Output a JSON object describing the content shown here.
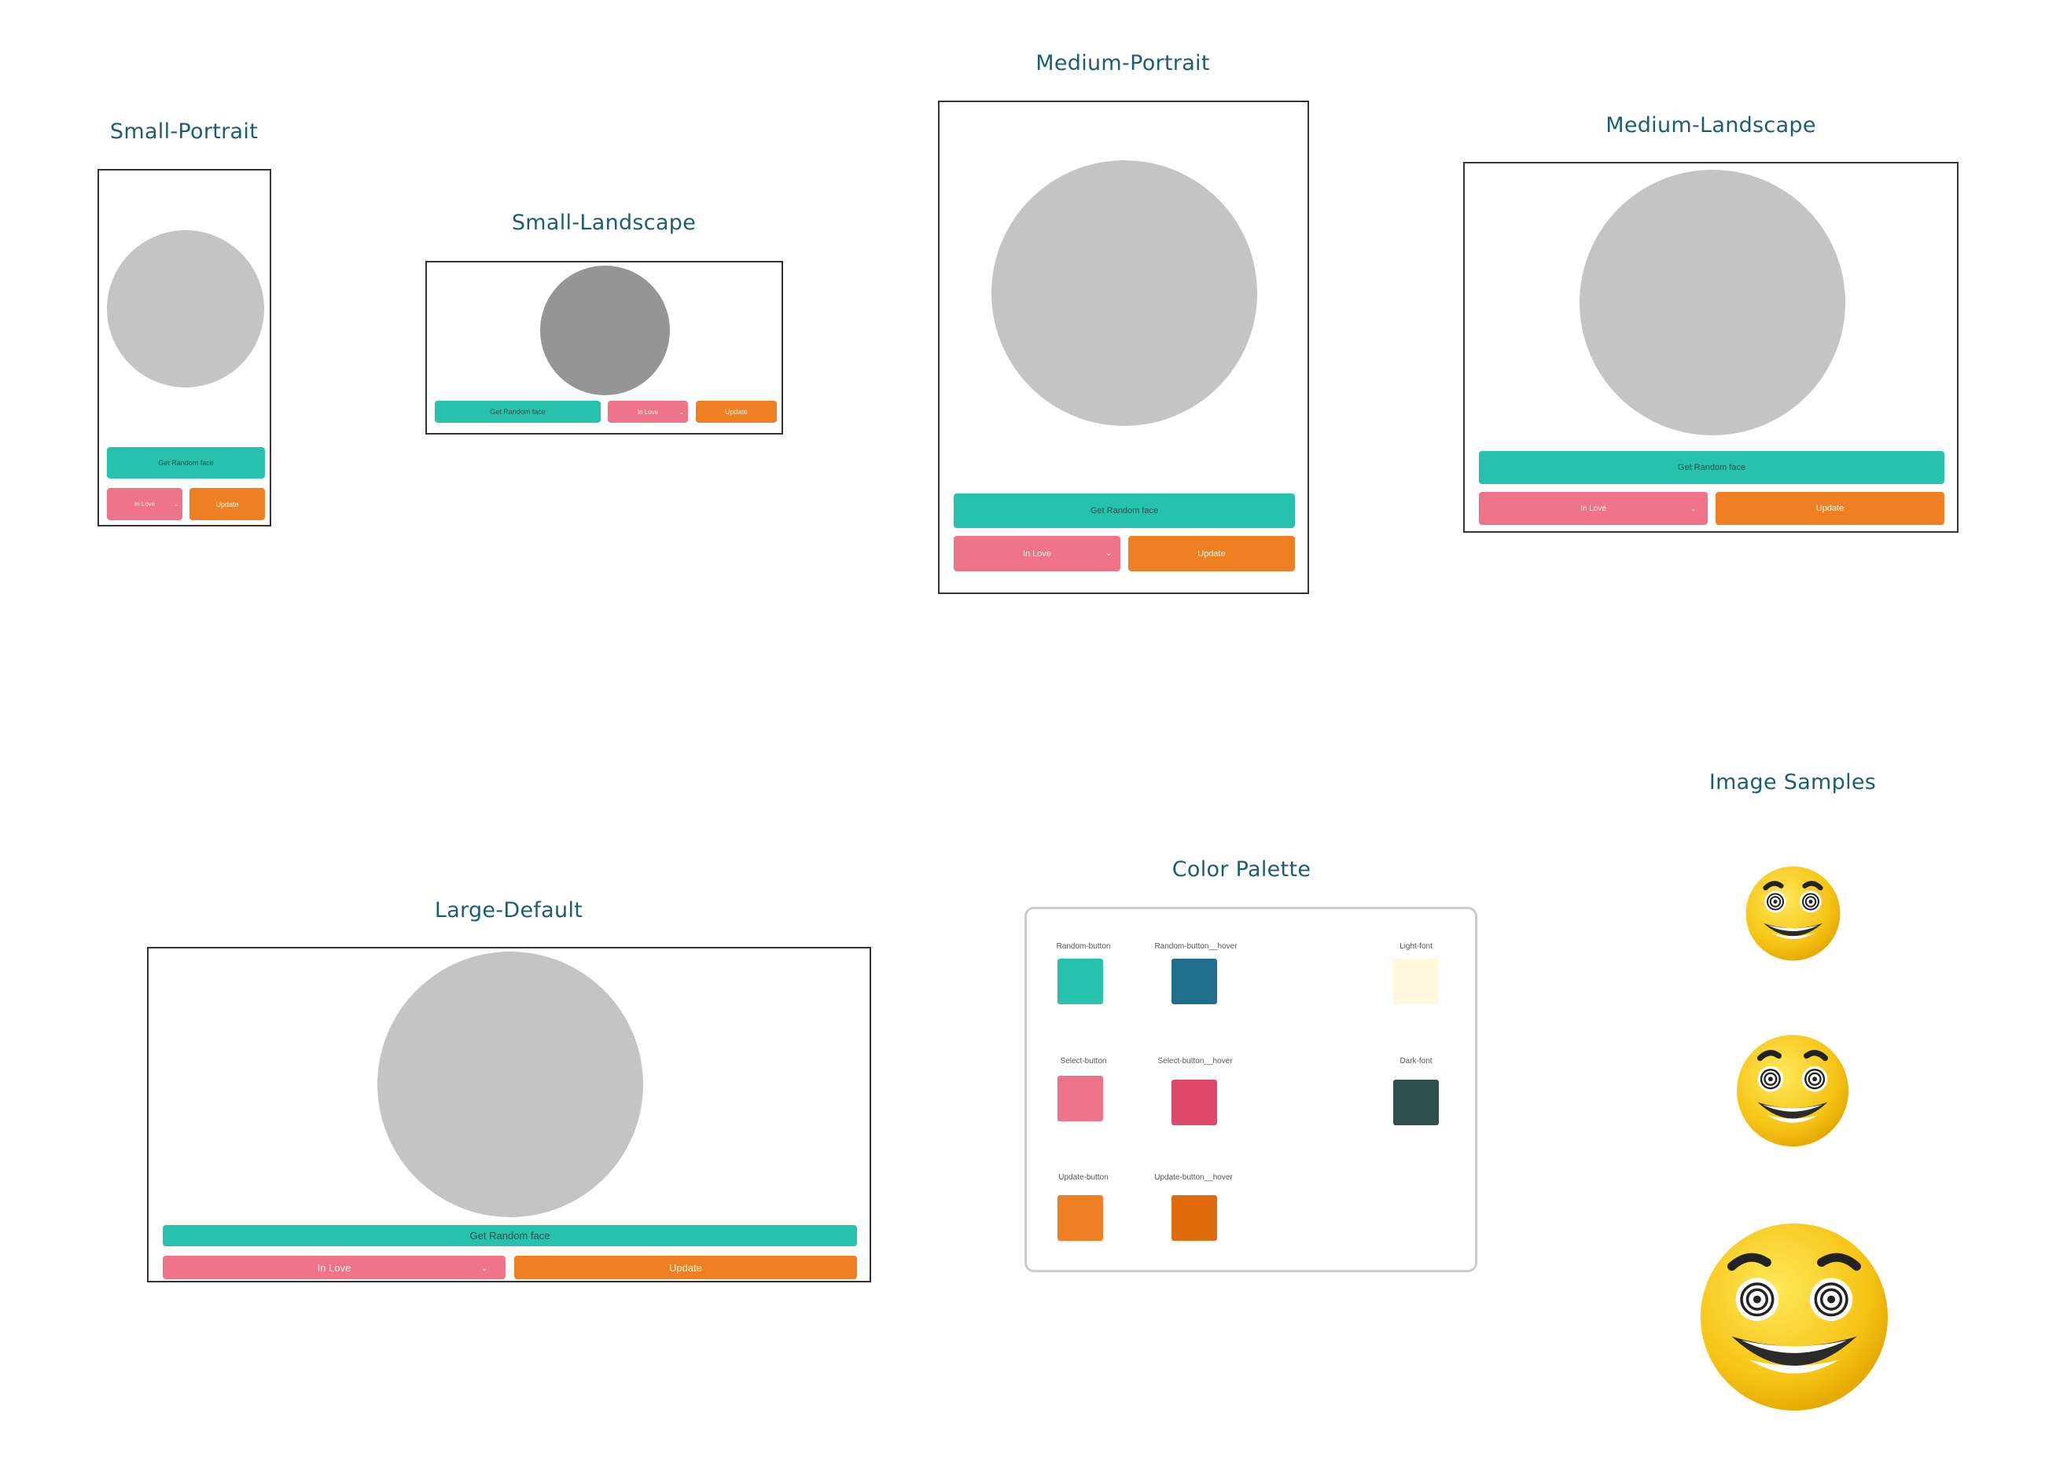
{
  "colors": {
    "random_button": "#26c2ae",
    "random_button_hover": "#1f6e8c",
    "select_button": "#f07489",
    "select_button_hover": "#e0486a",
    "update_button": "#f07e22",
    "update_button_hover": "#e06b0b",
    "light_font": "#fff8dc",
    "dark_font": "#2f4f4f",
    "frame_border": "#333333",
    "placeholder_circle": "#c4c4c4",
    "placeholder_circle_active": "#959595",
    "title_color": "#1b5e72"
  },
  "layouts": {
    "small_portrait": {
      "title": "Small-Portrait",
      "random_label": "Get Random face",
      "select_value": "In Love",
      "update_label": "Update"
    },
    "small_landscape": {
      "title": "Small-Landscape",
      "random_label": "Get Random face",
      "select_value": "In Love",
      "update_label": "Update"
    },
    "medium_portrait": {
      "title": "Medium-Portrait",
      "random_label": "Get Random face",
      "select_value": "In Love",
      "update_label": "Update"
    },
    "medium_landscape": {
      "title": "Medium-Landscape",
      "random_label": "Get Random face",
      "select_value": "In Love",
      "update_label": "Update"
    },
    "large_default": {
      "title": "Large-Default",
      "random_label": "Get Random face",
      "select_value": "In Love",
      "update_label": "Update"
    }
  },
  "palette": {
    "title": "Color Palette",
    "swatches": [
      {
        "label": "Random-button",
        "color": "#26c2ae"
      },
      {
        "label": "Random-button__hover",
        "color": "#1f6e8c"
      },
      {
        "label": "Light-font",
        "color": "#fff8dc"
      },
      {
        "label": "Select-button",
        "color": "#f07489"
      },
      {
        "label": "Select-button__hover",
        "color": "#e0486a"
      },
      {
        "label": "Dark-font",
        "color": "#2f4f4f"
      },
      {
        "label": "Update-button",
        "color": "#f07e22"
      },
      {
        "label": "Update-button__hover",
        "color": "#e06b0b"
      }
    ]
  },
  "samples": {
    "title": "Image Samples",
    "images": [
      {
        "icon": "hypnotized-smiley-face-icon"
      },
      {
        "icon": "hypnotized-smiley-face-icon"
      },
      {
        "icon": "hypnotized-smiley-face-icon"
      }
    ]
  }
}
